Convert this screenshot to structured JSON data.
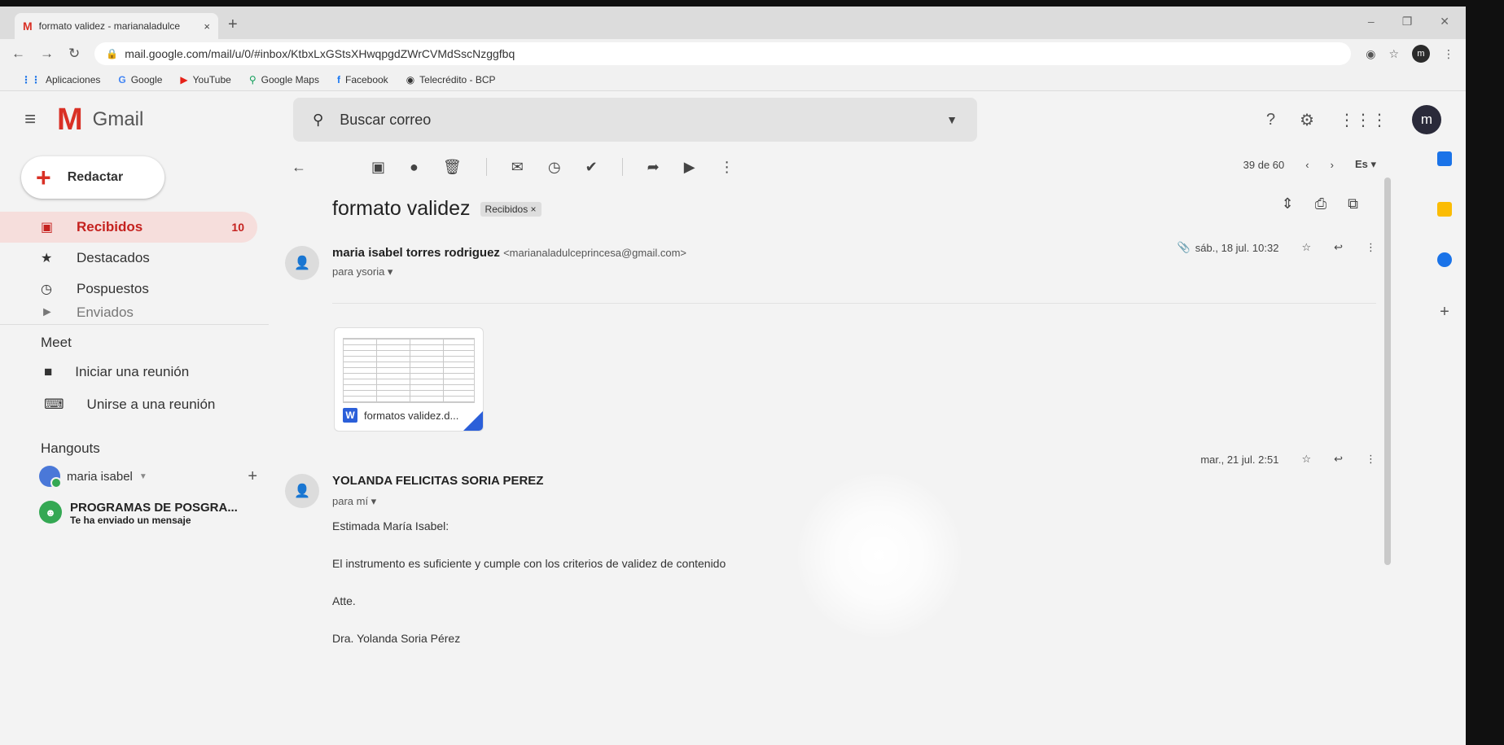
{
  "browser": {
    "tab_title": "formato validez - marianaladulce",
    "tab_close": "×",
    "new_tab": "+",
    "url": "mail.google.com/mail/u/0/#inbox/KtbxLxGStsXHwqpgdZWrCVMdSscNzggfbq",
    "profile_initial": "m",
    "bookmarks": [
      {
        "icon": "apps-grid-icon",
        "glyph": "⋮⋮",
        "label": "Aplicaciones"
      },
      {
        "icon": "google-icon",
        "glyph": "G",
        "label": "Google"
      },
      {
        "icon": "youtube-icon",
        "glyph": "▶",
        "label": "YouTube"
      },
      {
        "icon": "maps-pin-icon",
        "glyph": "⚲",
        "label": "Google Maps"
      },
      {
        "icon": "facebook-icon",
        "glyph": "f",
        "label": "Facebook"
      },
      {
        "icon": "globe-icon",
        "glyph": "◉",
        "label": "Telecrédito - BCP"
      }
    ]
  },
  "gmail": {
    "brand": "Gmail",
    "search_placeholder": "Buscar correo",
    "user_initial": "m"
  },
  "sidebar": {
    "compose_label": "Redactar",
    "items": [
      {
        "label": "Recibidos",
        "count": "10"
      },
      {
        "label": "Destacados",
        "count": ""
      },
      {
        "label": "Pospuestos",
        "count": ""
      },
      {
        "label": "Enviados",
        "count": ""
      }
    ],
    "meet_title": "Meet",
    "meet_items": [
      "Iniciar una reunión",
      "Unirse a una reunión"
    ],
    "hangouts_title": "Hangouts",
    "hangouts_user": "maria isabel",
    "hangouts_conv_title": "PROGRAMAS DE POSGRA...",
    "hangouts_conv_sub": "Te ha enviado un mensaje"
  },
  "thread": {
    "pager": "39 de 60",
    "lang": "Es",
    "subject": "formato validez",
    "label": "Recibidos ×",
    "messages": [
      {
        "sender_name": "maria isabel torres rodriguez",
        "sender_email": "<marianaladulceprincesa@gmail.com>",
        "to": "para ysoria ▾",
        "date": "sáb., 18 jul. 10:32",
        "attachment_name": "formatos validez.d..."
      },
      {
        "sender_name": "YOLANDA FELICITAS SORIA PEREZ",
        "to": "para mí ▾",
        "date": "mar., 21 jul. 2:51",
        "body": [
          "Estimada María Isabel:",
          "El instrumento es suficiente y cumple con los criterios de validez de contenido",
          "Atte.",
          "Dra. Yolanda Soria Pérez"
        ]
      }
    ]
  }
}
